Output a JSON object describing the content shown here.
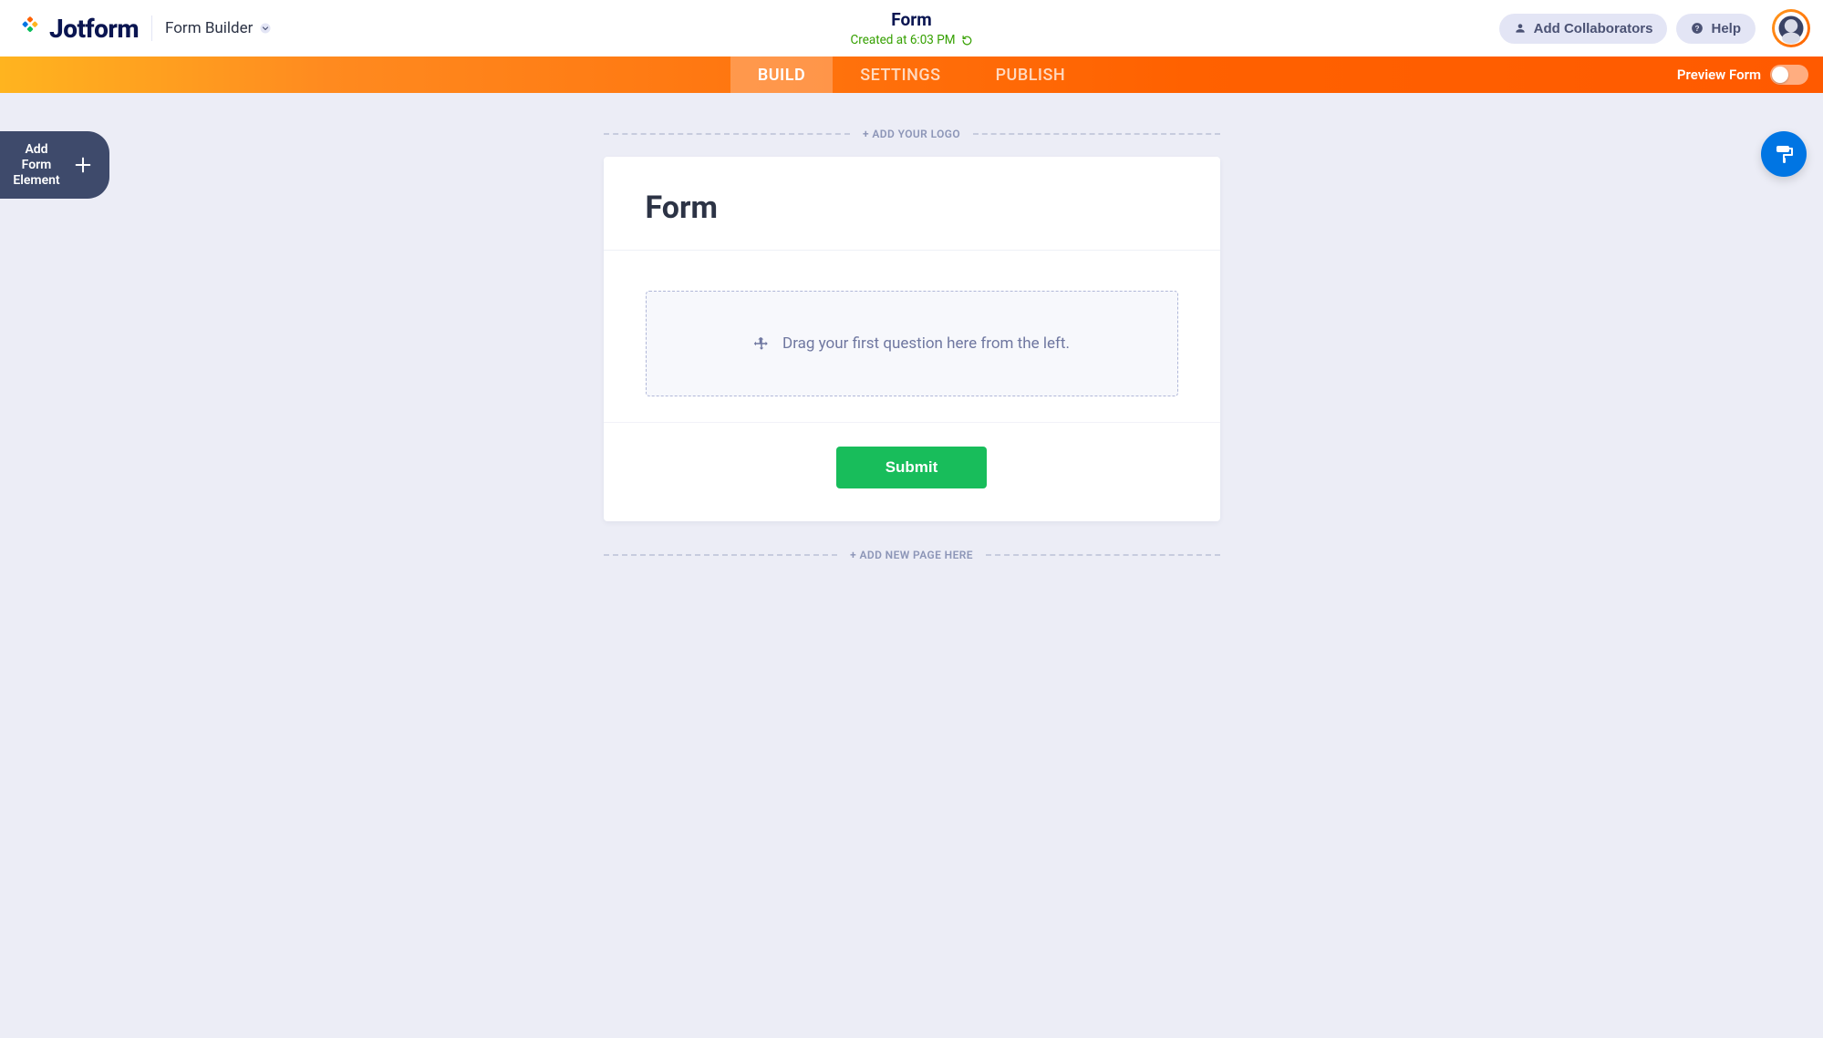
{
  "header": {
    "logo_text": "Jotform",
    "breadcrumb": "Form Builder",
    "form_title": "Form",
    "created_at": "Created at 6:03 PM",
    "add_collaborators_label": "Add Collaborators",
    "help_label": "Help"
  },
  "tabs": {
    "build": "BUILD",
    "settings": "SETTINGS",
    "publish": "PUBLISH",
    "preview_label": "Preview Form"
  },
  "sidebar": {
    "add_element_label": "Add Form Element"
  },
  "canvas": {
    "add_logo_label": "+ ADD YOUR LOGO",
    "form_head_title": "Form",
    "dropzone_text": "Drag your first question here from the left.",
    "submit_label": "Submit",
    "add_page_label": "+ ADD NEW PAGE HERE"
  }
}
